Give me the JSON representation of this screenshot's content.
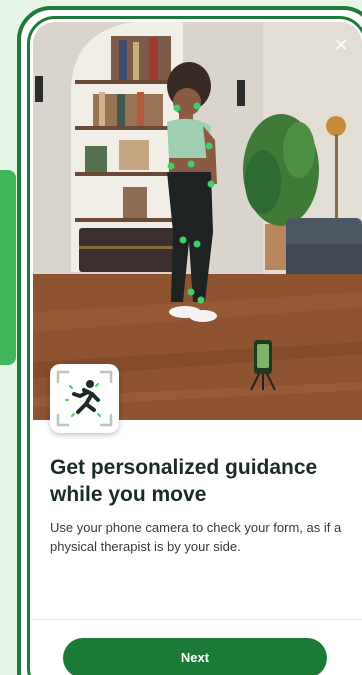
{
  "onboarding": {
    "title": "Get personalized guidance while you move",
    "description": "Use your phone camera to check your form, as if a physical therapist is by your side.",
    "next_label": "Next",
    "close_symbol": "×"
  },
  "icons": {
    "close": "close-icon",
    "feature": "motion-tracking-icon"
  },
  "colors": {
    "brand_green": "#1b7a35",
    "frame_green": "#1f7a3b",
    "accent_green": "#41b65b",
    "tracking_point": "#3fd06a",
    "background": "#e6f6e6"
  }
}
